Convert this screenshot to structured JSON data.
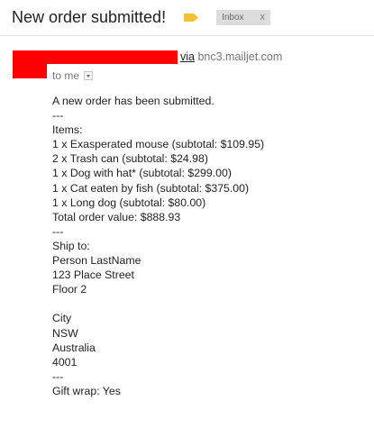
{
  "email": {
    "subject": "New order submitted!",
    "label_chip": "Inbox",
    "label_chip_close": "x",
    "via_word": "via",
    "via_domain": "bnc3.mailjet.com",
    "to_text": "to me",
    "body_lines": [
      "A new order has been submitted.",
      "---",
      "Items:",
      "1 x Exasperated mouse (subtotal: $109.95)",
      "2 x Trash can (subtotal: $24.98)",
      "1 x Dog with hat* (subtotal: $299.00)",
      "1 x Cat eaten by fish (subtotal: $375.00)",
      "1 x Long dog (subtotal: $80.00)",
      "Total order value: $888.93",
      "---",
      "Ship to:",
      "Person LastName",
      "123 Place Street",
      "Floor 2",
      "",
      "City",
      "NSW",
      "Australia",
      "4001",
      "---",
      "Gift wrap: Yes"
    ]
  },
  "colors": {
    "redaction": "#ff0000",
    "label_tag": "#f1c232",
    "chip_bg": "#dddddd"
  },
  "icons": {
    "label_tag": "label-tag-icon",
    "recipient_dropdown": "chevron-down-icon",
    "chip_remove": "close-icon"
  }
}
